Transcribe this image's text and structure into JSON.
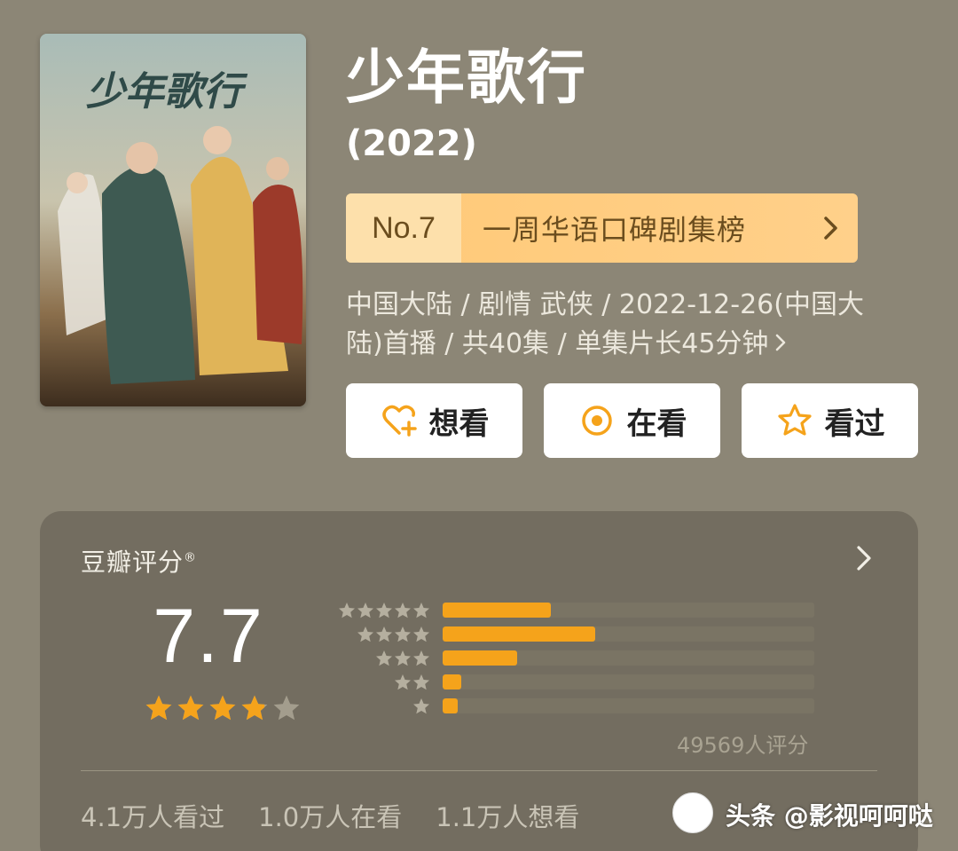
{
  "show": {
    "title": "少年歌行",
    "year": "(2022)",
    "poster_title_art": "少年歌行"
  },
  "rank": {
    "number": "No.7",
    "label": "一周华语口碑剧集榜"
  },
  "meta": {
    "line1": "中国大陆 / 剧情 武侠 / 2022-12-26(中国大",
    "line2": "陆)首播 / 共40集 / 单集片长45分钟"
  },
  "actions": [
    {
      "label": "想看",
      "icon": "heart-plus-icon"
    },
    {
      "label": "在看",
      "icon": "target-icon"
    },
    {
      "label": "看过",
      "icon": "star-outline-icon"
    }
  ],
  "rating": {
    "section_title": "豆瓣评分",
    "trademark": "®",
    "score": "7.7",
    "score_stars": 3.85,
    "distribution": [
      {
        "stars": 5,
        "fraction": 0.29
      },
      {
        "stars": 4,
        "fraction": 0.41
      },
      {
        "stars": 3,
        "fraction": 0.2
      },
      {
        "stars": 2,
        "fraction": 0.05
      },
      {
        "stars": 1,
        "fraction": 0.04
      }
    ],
    "count_text": "49569人评分"
  },
  "stats": {
    "watched": "4.1万人看过",
    "watching": "1.0万人在看",
    "want": "1.1万人想看"
  },
  "watermark": {
    "text": "头条 @影视呵呵哒"
  },
  "colors": {
    "background": "#8c8676",
    "accent": "#f5a31b",
    "rank_bg": "#ffc977",
    "rank_text": "#6b4d1e"
  }
}
